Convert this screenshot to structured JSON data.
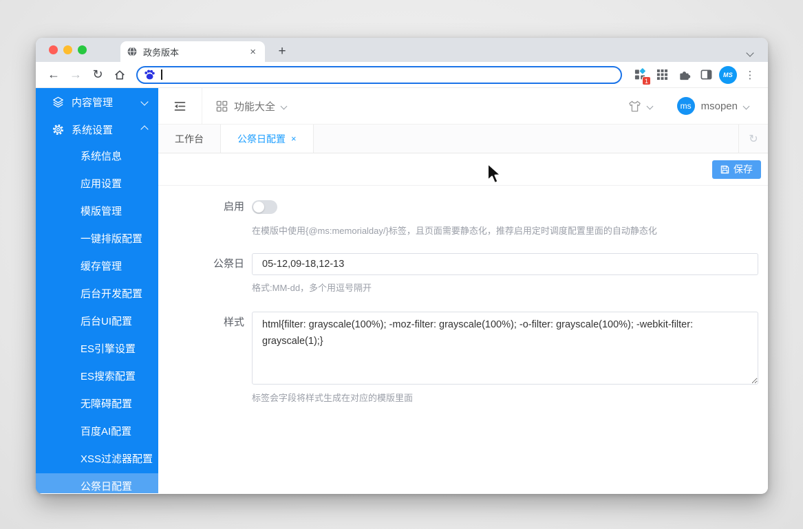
{
  "browser": {
    "tab": {
      "title": "政务版本"
    },
    "address": {
      "value": ""
    },
    "profile": {
      "avatar_text": "MS"
    },
    "extensions_badge": "1"
  },
  "app": {
    "sidebar": {
      "groups": [
        {
          "label": "内容管理"
        },
        {
          "label": "系统设置"
        }
      ],
      "items": [
        "系统信息",
        "应用设置",
        "模版管理",
        "一键排版配置",
        "缓存管理",
        "后台开发配置",
        "后台UI配置",
        "ES引擎设置",
        "ES搜索配置",
        "无障碍配置",
        "百度AI配置",
        "XSS过滤器配置",
        "公祭日配置"
      ],
      "selected_item": "公祭日配置"
    },
    "header": {
      "app_menu": "功能大全",
      "username": "msopen",
      "avatar_text": "ms"
    },
    "tabs": [
      {
        "label": "工作台"
      },
      {
        "label": "公祭日配置"
      }
    ],
    "active_tab": "公祭日配置",
    "toolbar": {
      "save_label": "保存"
    },
    "form": {
      "enable": {
        "label": "启用",
        "state": "off",
        "hint": "在模版中使用{@ms:memorialday/}标签，且页面需要静态化，推荐启用定时调度配置里面的自动静态化"
      },
      "memorial_day": {
        "label": "公祭日",
        "value": "05-12,09-18,12-13",
        "hint": "格式:MM-dd，多个用逗号隔开"
      },
      "style": {
        "label": "样式",
        "value": "html{filter: grayscale(100%); -moz-filter: grayscale(100%); -o-filter: grayscale(100%); -webkit-filter: grayscale(1);}",
        "hint": "标签会字段将样式生成在对应的模版里面"
      }
    }
  },
  "icons": {
    "close": "×",
    "new_tab": "+",
    "back": "←",
    "forward": "→",
    "reload": "↻",
    "refresh": "↻",
    "kebab": "⋮"
  },
  "colors": {
    "sidebar": "#1086f4",
    "sidebar_selected": "#54a5f4",
    "accent": "#1e9fff",
    "save_button": "#4da0f5",
    "focus_ring": "#1a73e8"
  }
}
